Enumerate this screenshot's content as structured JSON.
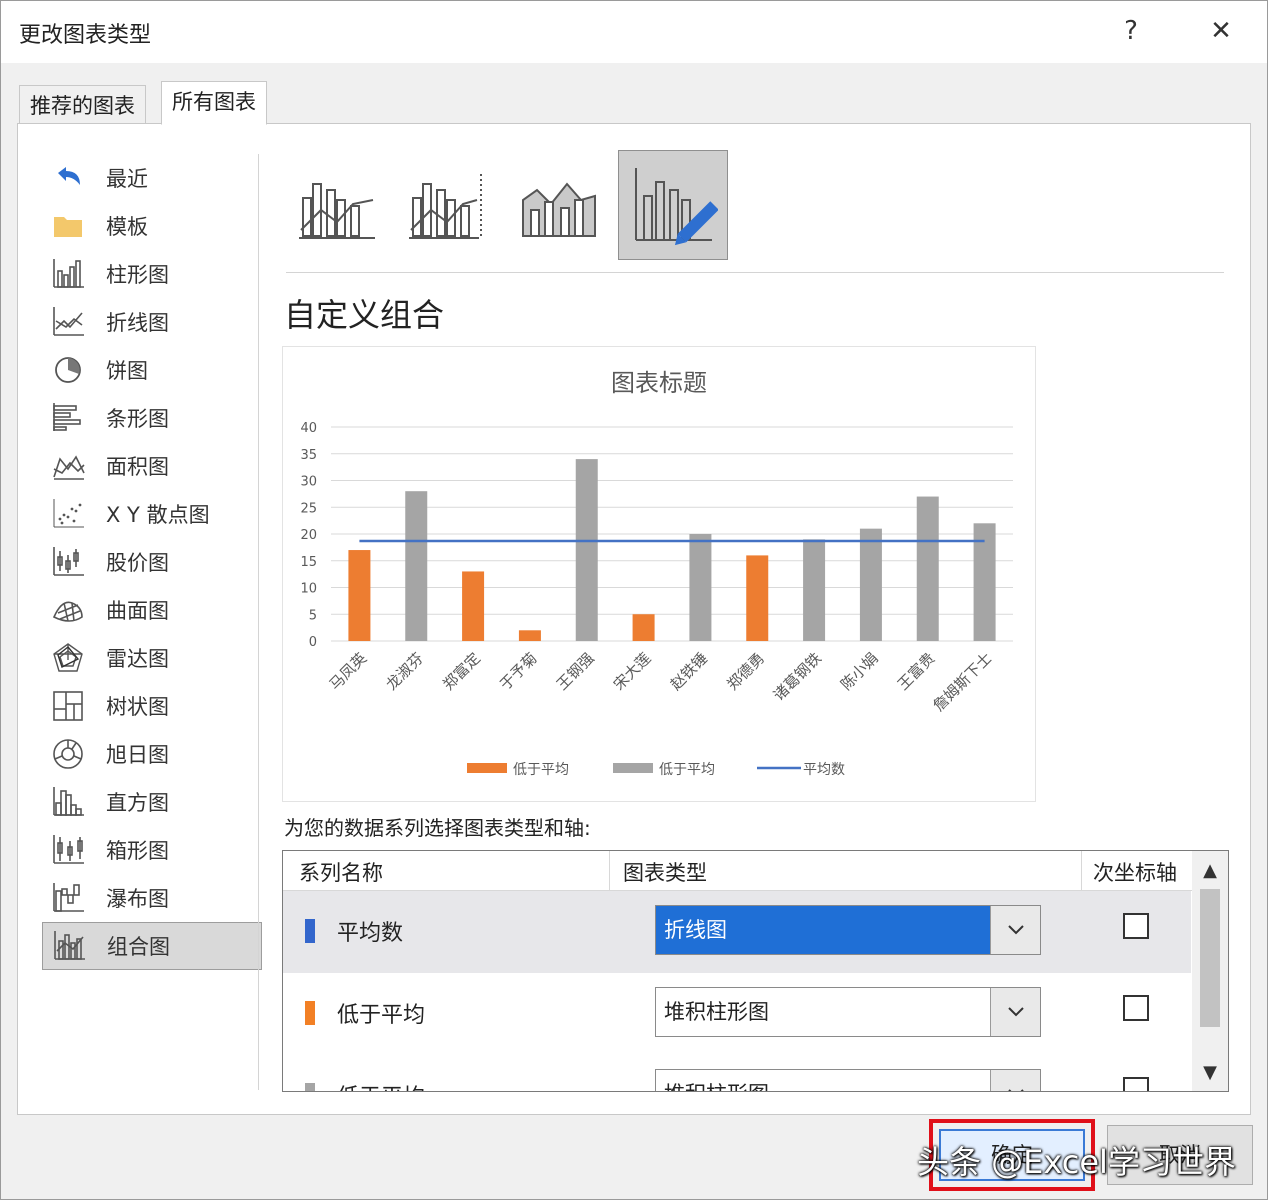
{
  "dialog": {
    "title": "更改图表类型",
    "help_symbol": "?",
    "close_symbol": "✕"
  },
  "tabs": [
    {
      "label": "推荐的图表",
      "active": false
    },
    {
      "label": "所有图表",
      "active": true
    }
  ],
  "sidebar": {
    "items": [
      {
        "label": "最近",
        "icon": "undo-arrow-icon"
      },
      {
        "label": "模板",
        "icon": "folder-icon"
      },
      {
        "label": "柱形图",
        "icon": "column-chart-icon"
      },
      {
        "label": "折线图",
        "icon": "line-chart-icon"
      },
      {
        "label": "饼图",
        "icon": "pie-chart-icon"
      },
      {
        "label": "条形图",
        "icon": "bar-chart-icon"
      },
      {
        "label": "面积图",
        "icon": "area-chart-icon"
      },
      {
        "label": "X Y 散点图",
        "icon": "scatter-chart-icon"
      },
      {
        "label": "股价图",
        "icon": "stock-chart-icon"
      },
      {
        "label": "曲面图",
        "icon": "surface-chart-icon"
      },
      {
        "label": "雷达图",
        "icon": "radar-chart-icon"
      },
      {
        "label": "树状图",
        "icon": "treemap-chart-icon"
      },
      {
        "label": "旭日图",
        "icon": "sunburst-chart-icon"
      },
      {
        "label": "直方图",
        "icon": "histogram-chart-icon"
      },
      {
        "label": "箱形图",
        "icon": "box-whisker-chart-icon"
      },
      {
        "label": "瀑布图",
        "icon": "waterfall-chart-icon"
      },
      {
        "label": "组合图",
        "icon": "combo-chart-icon",
        "selected": true
      }
    ]
  },
  "subtypes": [
    {
      "icon": "clustered-column-line-icon",
      "selected": false
    },
    {
      "icon": "clustered-column-line-secondary-axis-icon",
      "selected": false
    },
    {
      "icon": "stacked-area-clustered-column-icon",
      "selected": false
    },
    {
      "icon": "custom-combination-icon",
      "selected": true
    }
  ],
  "section_heading": "自定义组合",
  "series_prompt": "为您的数据系列选择图表类型和轴:",
  "series_grid": {
    "headers": {
      "name": "系列名称",
      "type": "图表类型",
      "secondary_axis": "次坐标轴"
    },
    "rows": [
      {
        "name": "平均数",
        "color": "#3366cc",
        "chart_type": "折线图",
        "secondary_axis": false,
        "selected": true
      },
      {
        "name": "低于平均",
        "color": "#f28025",
        "chart_type": "堆积柱形图",
        "secondary_axis": false,
        "selected": false
      },
      {
        "name": "低于平均",
        "color": "#a5a5a5",
        "chart_type": "堆积柱形图",
        "secondary_axis": false,
        "selected": false
      }
    ]
  },
  "buttons": {
    "ok": "确定",
    "cancel": "取消"
  },
  "watermark": "头条 @Excel学习世界",
  "colors": {
    "orange": "#ed7d31",
    "gray": "#a5a5a5",
    "blue": "#4472c4",
    "selection": "#1f6fd6"
  },
  "chart_data": {
    "type": "bar",
    "title": "图表标题",
    "categories": [
      "马凤英",
      "龙淑芬",
      "郑富定",
      "于予菊",
      "王钢强",
      "宋大莲",
      "赵铁锤",
      "郑德勇",
      "诸葛钢铁",
      "陈小娟",
      "王富贵",
      "詹姆斯下士"
    ],
    "series": [
      {
        "name": "低于平均",
        "kind": "bar",
        "color": "#ed7d31",
        "values": [
          17,
          null,
          13,
          2,
          null,
          5,
          null,
          16,
          null,
          null,
          null,
          null
        ]
      },
      {
        "name": "低于平均",
        "kind": "bar",
        "color": "#a5a5a5",
        "values": [
          null,
          28,
          null,
          null,
          34,
          null,
          20,
          null,
          19,
          21,
          27,
          22
        ]
      },
      {
        "name": "平均数",
        "kind": "line",
        "color": "#4472c4",
        "values": [
          18.7,
          18.7,
          18.7,
          18.7,
          18.7,
          18.7,
          18.7,
          18.7,
          18.7,
          18.7,
          18.7,
          18.7
        ]
      }
    ],
    "ylim": [
      0,
      40
    ],
    "yticks": [
      0,
      5,
      10,
      15,
      20,
      25,
      30,
      35,
      40
    ],
    "grid": true,
    "legend": "bottom"
  }
}
